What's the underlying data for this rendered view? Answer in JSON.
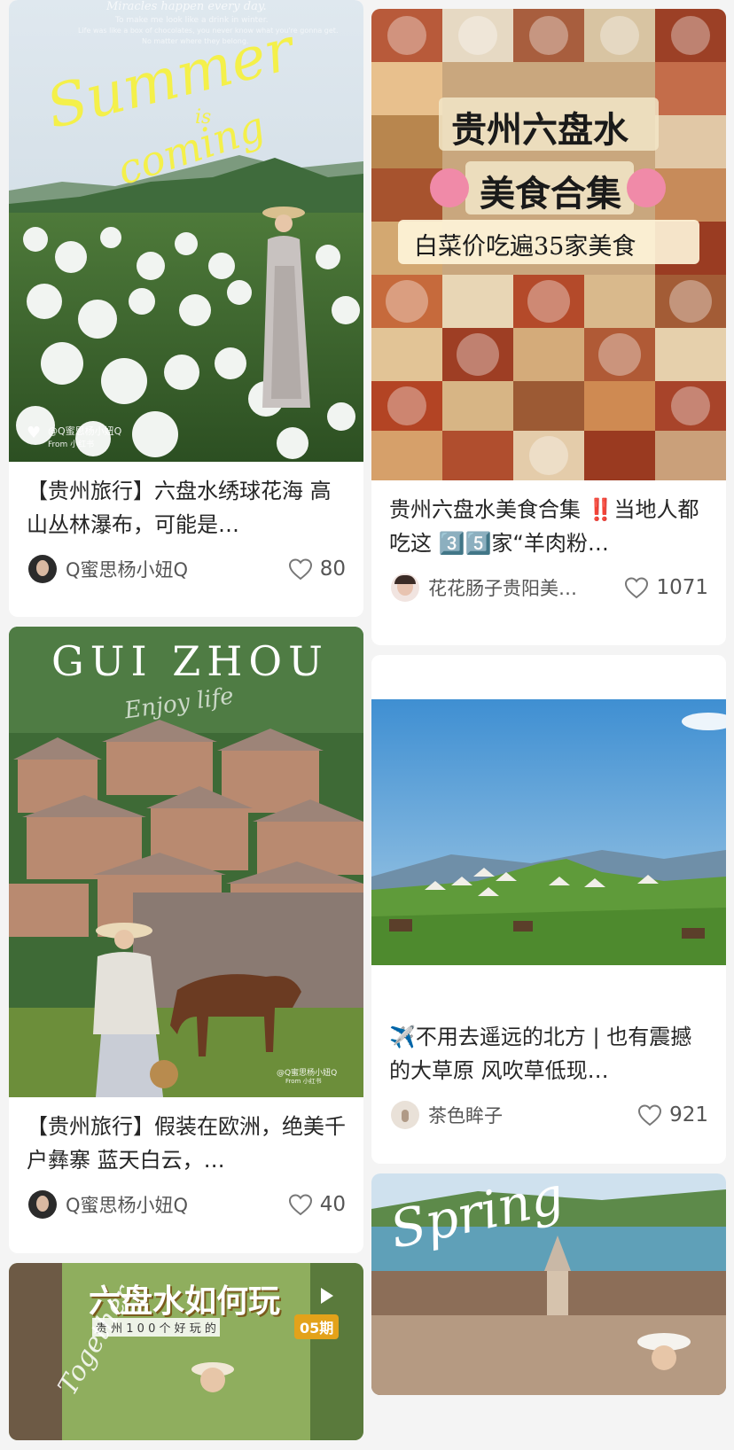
{
  "cards": {
    "c1": {
      "image_text": {
        "top_line1": "Miracles happen every day.",
        "top_line2": "To make me look like a drink in winter.",
        "top_line3": "Life was like a box of chocolates, you never know what you're gonna get.",
        "top_line4": "No matter where they belong.",
        "script1": "Summer",
        "script2": "is",
        "script3": "coming",
        "watermark": "@Q蜜思杨小妞Q",
        "watermark_sub": "From 小红书"
      },
      "title": "【贵州旅行】六盘水绣球花海 高山丛林瀑布，可能是…",
      "author": "Q蜜思杨小妞Q",
      "likes": "80"
    },
    "c2": {
      "image_text": {
        "line1": "贵州六盘水",
        "line2": "美食合集",
        "line3": "白菜价吃遍35家美食"
      },
      "title": "贵州六盘水美食合集 ‼️当地人都吃这 3️⃣5️⃣家“羊肉粉…",
      "author": "花花肠子贵阳美…",
      "likes": "1071"
    },
    "c3": {
      "image_text": {
        "heading": "GUI ZHOU",
        "script": "Enjoy life",
        "watermark": "@Q蜜思杨小妞Q",
        "watermark_sub": "From 小红书"
      },
      "title": "【贵州旅行】假装在欧洲，绝美千户彝寨 蓝天白云，…",
      "author": "Q蜜思杨小妞Q",
      "likes": "40"
    },
    "c4": {
      "title": "✈️不用去遥远的北方 | 也有震撼的大草原 风吹草低现…",
      "author": "茶色眸子",
      "likes": "921"
    },
    "c5": {
      "image_text": {
        "heading": "六盘水如何玩",
        "sub": "贵 州 1 0 0 个 好 玩 的",
        "badge": "05期",
        "script": "Together"
      }
    },
    "c6": {
      "image_text": {
        "script": "Spring"
      }
    }
  }
}
